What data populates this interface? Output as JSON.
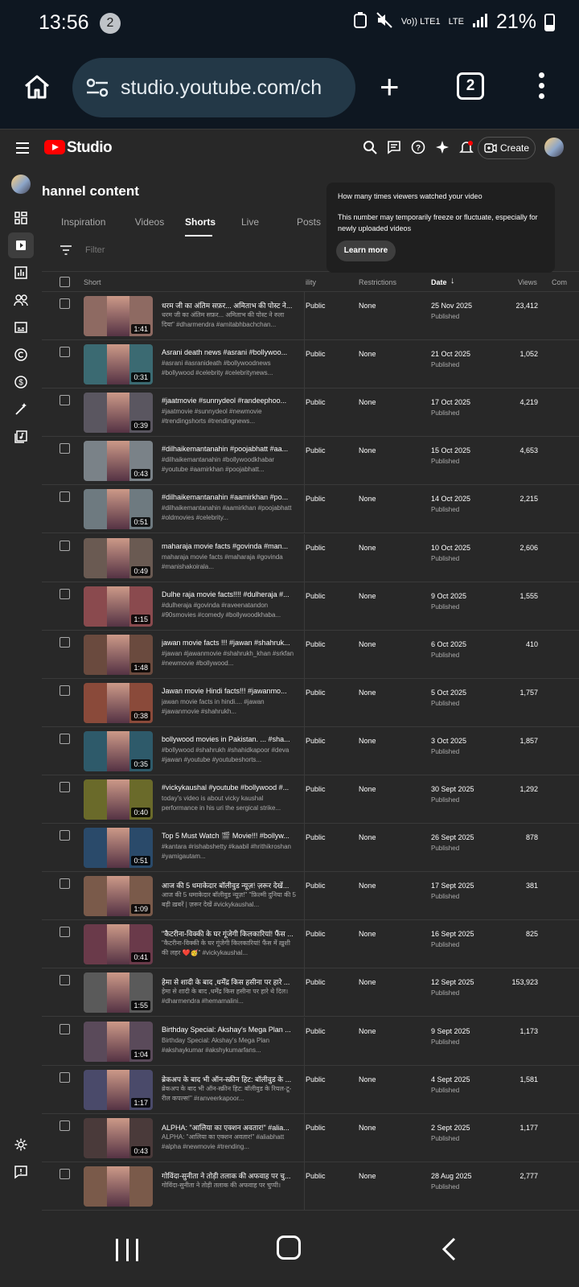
{
  "status_bar": {
    "time": "13:56",
    "notif_count": "2",
    "network": "Vo)) LTE1",
    "net_type": "LTE",
    "battery": "21%"
  },
  "browser": {
    "url": "studio.youtube.com/ch",
    "tab_count": "2"
  },
  "studio": {
    "logo_text": "Studio",
    "create_label": "Create",
    "page_title": "hannel content",
    "tabs": [
      "Inspiration",
      "Videos",
      "Shorts",
      "Live",
      "Posts"
    ],
    "active_tab": "Shorts",
    "filter_placeholder": "Filter",
    "columns": {
      "short": "Short",
      "visibility": "ility",
      "restrictions": "Restrictions",
      "date": "Date",
      "views": "Views",
      "comments": "Com"
    },
    "tooltip": {
      "title": "How many times viewers watched your video",
      "body": "This number may temporarily freeze or fluctuate, especially for newly uploaded videos",
      "button": "Learn more"
    },
    "rows": [
      {
        "title": "धरम जी का अंतिम सफ़र... अमिताभ की पोस्ट ने...",
        "desc": "धरम जी का अंतिम सफ़र... अमिताभ की पोस्ट ने रुला दिया\" #dharmendra #amitabhbachchan...",
        "duration": "1:41",
        "visibility": "Public",
        "restrictions": "None",
        "date": "25 Nov 2025",
        "status": "Published",
        "views": "23,412",
        "thumb_color": "#8e6a62"
      },
      {
        "title": "Asrani death news #asrani #bollywoo...",
        "desc": "#asrani #asranideath #bollywoodnews #bollywood #celebrity #celebritynews...",
        "duration": "0:31",
        "visibility": "Public",
        "restrictions": "None",
        "date": "21 Oct 2025",
        "status": "Published",
        "views": "1,052",
        "thumb_color": "#3b6a72"
      },
      {
        "title": "#jaatmovie #sunnydeol #randeephoo...",
        "desc": "#jaatmovie #sunnydeol #newmovie #trendingshorts #trendingnews...",
        "duration": "0:39",
        "visibility": "Public",
        "restrictions": "None",
        "date": "17 Oct 2025",
        "status": "Published",
        "views": "4,219",
        "thumb_color": "#5a5660"
      },
      {
        "title": "#dilhaikemantanahin #poojabhatt #aa...",
        "desc": "#dilhaikemantanahin #bollywoodkhabar #youtube #aamirkhan #poojabhatt...",
        "duration": "0:43",
        "visibility": "Public",
        "restrictions": "None",
        "date": "15 Oct 2025",
        "status": "Published",
        "views": "4,653",
        "thumb_color": "#7a8288"
      },
      {
        "title": "#dilhaikemantanahin #aamirkhan #po...",
        "desc": "#dilhaikemantanahin #aamirkhan #poojabhatt #oldmovies #celebrity...",
        "duration": "0:51",
        "visibility": "Public",
        "restrictions": "None",
        "date": "14 Oct 2025",
        "status": "Published",
        "views": "2,215",
        "thumb_color": "#6e7a80"
      },
      {
        "title": "maharaja movie facts #govinda #man...",
        "desc": "maharaja movie facts #maharaja #govinda #manishakoirala...",
        "duration": "0:49",
        "visibility": "Public",
        "restrictions": "None",
        "date": "10 Oct 2025",
        "status": "Published",
        "views": "2,606",
        "thumb_color": "#6a5a52"
      },
      {
        "title": "Dulhe raja movie facts!!!! #dulheraja #...",
        "desc": "#dulheraja #govinda #raveenatandon #90smovies #comedy #bollywoodkhaba...",
        "duration": "1:15",
        "visibility": "Public",
        "restrictions": "None",
        "date": "9 Oct 2025",
        "status": "Published",
        "views": "1,555",
        "thumb_color": "#8a4a4e"
      },
      {
        "title": "jawan movie facts !!! #jawan #shahruk...",
        "desc": "#jawan #jawanmovie #shahrukh_khan #srkfan #newmovie #bollywood...",
        "duration": "1:48",
        "visibility": "Public",
        "restrictions": "None",
        "date": "6 Oct 2025",
        "status": "Published",
        "views": "410",
        "thumb_color": "#6a4a3e"
      },
      {
        "title": "Jawan movie Hindi facts!!! #jawanmo...",
        "desc": "jawan movie facts in hindi.... #jawan #jawanmovie #shahrukh...",
        "duration": "0:38",
        "visibility": "Public",
        "restrictions": "None",
        "date": "5 Oct 2025",
        "status": "Published",
        "views": "1,757",
        "thumb_color": "#8a4a3a"
      },
      {
        "title": "bollywood movies in Pakistan. ... #sha...",
        "desc": "#bollywood #shahrukh #shahidkapoor #deva #jawan #youtube #youtubeshorts...",
        "duration": "0:35",
        "visibility": "Public",
        "restrictions": "None",
        "date": "3 Oct 2025",
        "status": "Published",
        "views": "1,857",
        "thumb_color": "#2e5a6a"
      },
      {
        "title": "#vickykaushal #youtube #bollywood #...",
        "desc": "today's video is about vicky kaushal performance in his uri the sergical strike...",
        "duration": "0:40",
        "visibility": "Public",
        "restrictions": "None",
        "date": "30 Sept 2025",
        "status": "Published",
        "views": "1,292",
        "thumb_color": "#6a6a2a"
      },
      {
        "title": "Top 5 Must Watch 🎬 Movie!!! #bollyw...",
        "desc": "#kantara #rishabshetty #kaabil #hrithikroshan #yamigautam...",
        "duration": "0:51",
        "visibility": "Public",
        "restrictions": "None",
        "date": "26 Sept 2025",
        "status": "Published",
        "views": "878",
        "thumb_color": "#2a4a6a"
      },
      {
        "title": "आज की 5 धमाकेदार बॉलीवुड न्यूज़! ज़रूर देखें...",
        "desc": "आज की 5 धमाकेदार बॉलीवुड न्यूज़!\" \"फ़िल्मी दुनिया की 5 बड़ी ख़बरें | ज़रूर देखें #vickykaushal...",
        "duration": "1:09",
        "visibility": "Public",
        "restrictions": "None",
        "date": "17 Sept 2025",
        "status": "Published",
        "views": "381",
        "thumb_color": "#7a5a4a"
      },
      {
        "title": "\"कैटरीना-विक्की के घर गूंजेगी किलकारियां! फैंस ...",
        "desc": "\"कैटरीना-विक्की के घर गूंजेगी किलकारियां! फैंस में ख़ुशी की लहर ❤️🥳\" #vickykaushal...",
        "duration": "0:41",
        "visibility": "Public",
        "restrictions": "None",
        "date": "16 Sept 2025",
        "status": "Published",
        "views": "825",
        "thumb_color": "#6a3a4a"
      },
      {
        "title": "हेमा से शादी के बाद ,धर्मेंद्र किस हसीना पर हारे ...",
        "desc": "हेमा से शादी के बाद ,धर्मेंद्र किस हसीना पर हारे थे दिल। #dharmendra #hemamalini...",
        "duration": "1:55",
        "visibility": "Public",
        "restrictions": "None",
        "date": "12 Sept 2025",
        "status": "Published",
        "views": "153,923",
        "thumb_color": "#5a5a5a"
      },
      {
        "title": "Birthday Special: Akshay's Mega Plan ...",
        "desc": "Birthday Special: Akshay's Mega Plan #akshaykumar #akshykumarfans...",
        "duration": "1:04",
        "visibility": "Public",
        "restrictions": "None",
        "date": "9 Sept 2025",
        "status": "Published",
        "views": "1,173",
        "thumb_color": "#5a4a5a"
      },
      {
        "title": "ब्रेकअप के बाद भी ऑन-स्क्रीन हिट: बॉलीवुड के ...",
        "desc": "ब्रेकअप के बाद भी ऑन-स्क्रीन हिट: बॉलीवुड के रियल-टू-रील कपल्स!\" #ranveerkapoor...",
        "duration": "1:17",
        "visibility": "Public",
        "restrictions": "None",
        "date": "4 Sept 2025",
        "status": "Published",
        "views": "1,581",
        "thumb_color": "#4a4a6a"
      },
      {
        "title": "ALPHA: \"आलिया का एक्शन अवतार!\" #alia...",
        "desc": "ALPHA: \"आलिया का एक्शन अवतार!\" #aliabhatt #alpha #newmovie #trending...",
        "duration": "0:43",
        "visibility": "Public",
        "restrictions": "None",
        "date": "2 Sept 2025",
        "status": "Published",
        "views": "1,177",
        "thumb_color": "#4a3a3a"
      },
      {
        "title": "गोविंदा-सुनीता ने तोड़ी तलाक की अफवाह पर चु...",
        "desc": "गोविंदा-सुनीता ने तोड़ी तलाक की अफवाह पर चुप्पी।",
        "duration": "",
        "visibility": "Public",
        "restrictions": "None",
        "date": "28 Aug 2025",
        "status": "Published",
        "views": "2,777",
        "thumb_color": "#7a5a4a"
      }
    ]
  },
  "colors": {
    "chrome_bg": "#0e1721",
    "url_bg": "#233847",
    "studio_bg": "#282828",
    "yt_red": "#ff0000"
  }
}
